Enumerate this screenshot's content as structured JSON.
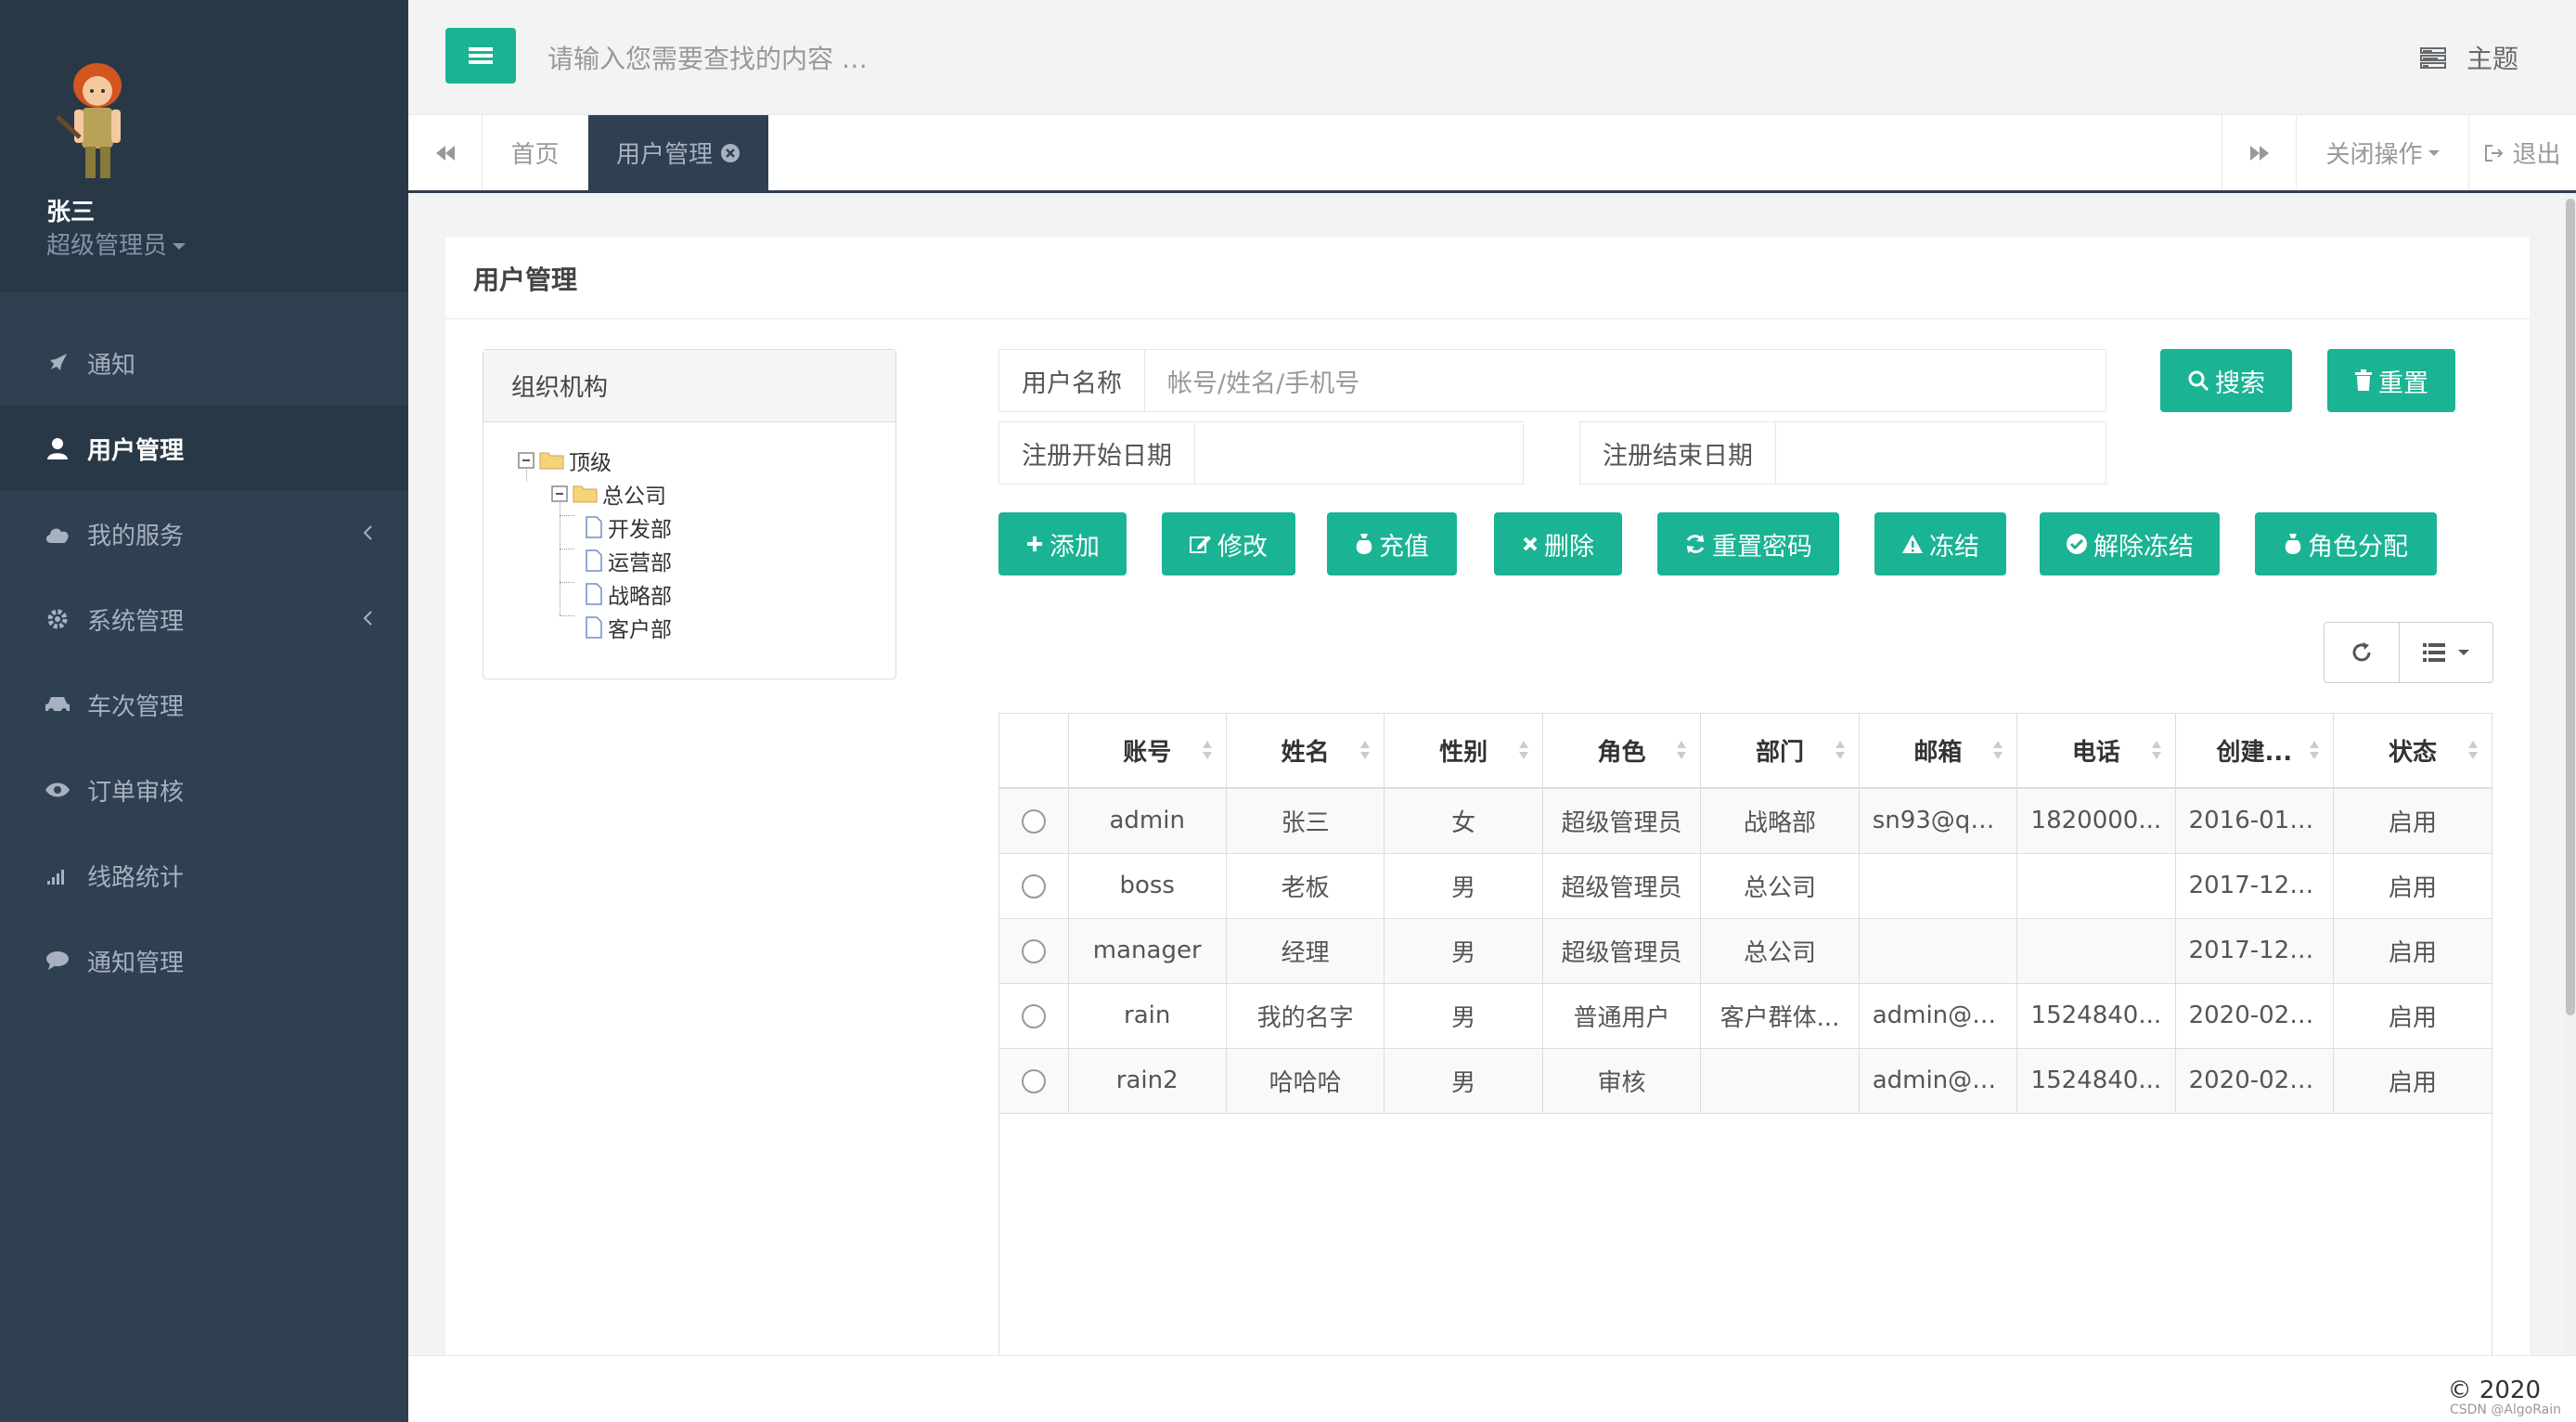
{
  "colors": {
    "sidebar": "#2f4050",
    "accent": "#1ab394",
    "topbar": "#f3f3f4"
  },
  "sidebar": {
    "user_name": "张三",
    "user_role": "超级管理员",
    "items": [
      {
        "label": "通知",
        "icon": "rocket-icon"
      },
      {
        "label": "用户管理",
        "icon": "user-icon",
        "active": true
      },
      {
        "label": "我的服务",
        "icon": "cloud-icon",
        "submenu": true
      },
      {
        "label": "系统管理",
        "icon": "gear-icon",
        "submenu": true
      },
      {
        "label": "车次管理",
        "icon": "car-icon"
      },
      {
        "label": "订单审核",
        "icon": "eye-icon"
      },
      {
        "label": "线路统计",
        "icon": "signal-icon"
      },
      {
        "label": "通知管理",
        "icon": "comment-icon"
      }
    ]
  },
  "topbar": {
    "search_placeholder": "请输入您需要查找的内容 …",
    "theme_label": "主题"
  },
  "tabs": {
    "items": [
      {
        "label": "首页"
      },
      {
        "label": "用户管理",
        "active": true
      }
    ],
    "close_ops": "关闭操作",
    "logout": "退出"
  },
  "panel": {
    "title": "用户管理",
    "org": {
      "title": "组织机构",
      "tree": {
        "root": "顶级",
        "company": "总公司",
        "departments": [
          "开发部",
          "运营部",
          "战略部",
          "客户部"
        ]
      }
    },
    "search": {
      "user_label": "用户名称",
      "user_placeholder": "帐号/姓名/手机号",
      "start_label": "注册开始日期",
      "end_label": "注册结束日期",
      "search_btn": "搜索",
      "reset_btn": "重置"
    },
    "actions": [
      "添加",
      "修改",
      "充值",
      "删除",
      "重置密码",
      "冻结",
      "解除冻结",
      "角色分配"
    ],
    "table": {
      "columns": [
        "账号",
        "姓名",
        "性别",
        "角色",
        "部门",
        "邮箱",
        "电话",
        "创建...",
        "状态"
      ],
      "rows": [
        [
          "admin",
          "张三",
          "女",
          "超级管理员",
          "战略部",
          "sn93@qq...",
          "1820000...",
          "2016-01-...",
          "启用"
        ],
        [
          "boss",
          "老板",
          "男",
          "超级管理员",
          "总公司",
          "",
          "",
          "2017-12-...",
          "启用"
        ],
        [
          "manager",
          "经理",
          "男",
          "超级管理员",
          "总公司",
          "",
          "",
          "2017-12-...",
          "启用"
        ],
        [
          "rain",
          "我的名字",
          "男",
          "普通用户",
          "客户群体...",
          "admin@1...",
          "1524840...",
          "2020-02-...",
          "启用"
        ],
        [
          "rain2",
          "哈哈哈",
          "男",
          "审核",
          "",
          "admin@1...",
          "1524840...",
          "2020-02-...",
          "启用"
        ]
      ]
    }
  },
  "footer": {
    "copyright": "© 2020",
    "watermark": "CSDN @AlgoRain"
  }
}
